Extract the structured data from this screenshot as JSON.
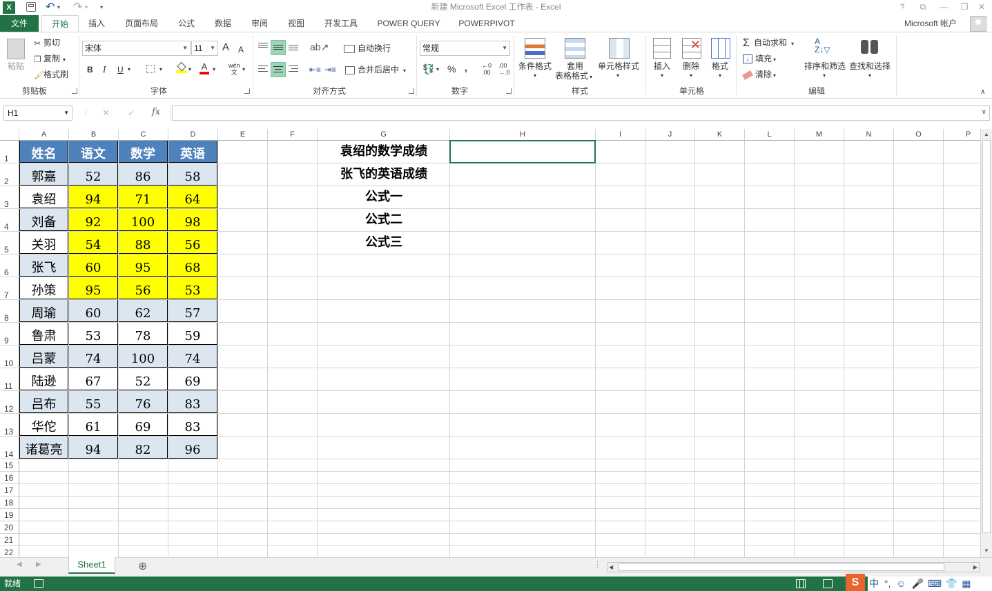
{
  "window": {
    "title": "新建 Microsoft Excel 工作表 - Excel",
    "help": "?",
    "restore_ribbon": "⧉",
    "minimize": "—",
    "maximize": "❐",
    "close": "✕",
    "account": "Microsoft 帐户"
  },
  "qat": {
    "undo": "↶",
    "redo": "↷",
    "more": "▾"
  },
  "tabs": [
    "文件",
    "开始",
    "插入",
    "页面布局",
    "公式",
    "数据",
    "审阅",
    "视图",
    "开发工具",
    "POWER QUERY",
    "POWERPIVOT"
  ],
  "ribbon": {
    "clipboard": {
      "paste": "粘贴",
      "cut": "剪切",
      "copy": "复制",
      "format_painter": "格式刷",
      "label": "剪贴板"
    },
    "font": {
      "name": "宋体",
      "size": "11",
      "grow": "A",
      "shrink": "A",
      "bold": "B",
      "italic": "I",
      "underline": "U",
      "phonetic": "wén",
      "label": "字体"
    },
    "alignment": {
      "wrap": "自动换行",
      "merge": "合并后居中",
      "label": "对齐方式"
    },
    "number": {
      "format": "常规",
      "percent": "%",
      "comma": ",",
      "inc_dec": ".00",
      "label": "数字"
    },
    "styles": {
      "conditional": "条件格式",
      "table_line1": "套用",
      "table_line2": "表格格式",
      "cell_styles": "单元格样式",
      "label": "样式"
    },
    "cells": {
      "insert": "插入",
      "delete": "删除",
      "format": "格式",
      "label": "单元格"
    },
    "editing": {
      "autosum": "自动求和",
      "fill": "填充",
      "clear": "清除",
      "sort": "排序和筛选",
      "find": "查找和选择",
      "label": "编辑"
    }
  },
  "formula_bar": {
    "name_box": "H1",
    "fx": "fx",
    "cancel": "✕",
    "enter": "✓",
    "value": ""
  },
  "columns": [
    "A",
    "B",
    "C",
    "D",
    "E",
    "F",
    "G",
    "H",
    "I",
    "J",
    "K",
    "L",
    "M",
    "N",
    "O",
    "P"
  ],
  "rows": [
    "1",
    "2",
    "3",
    "4",
    "5",
    "6",
    "7",
    "8",
    "9",
    "10",
    "11",
    "12",
    "13",
    "14",
    "15",
    "16",
    "17",
    "18",
    "19",
    "20",
    "21",
    "22"
  ],
  "table": {
    "header": [
      "姓名",
      "语文",
      "数学",
      "英语"
    ],
    "rows": [
      [
        "郭嘉",
        "52",
        "86",
        "58"
      ],
      [
        "袁绍",
        "94",
        "71",
        "64"
      ],
      [
        "刘备",
        "92",
        "100",
        "98"
      ],
      [
        "关羽",
        "54",
        "88",
        "56"
      ],
      [
        "张飞",
        "60",
        "95",
        "68"
      ],
      [
        "孙策",
        "95",
        "56",
        "53"
      ],
      [
        "周瑜",
        "60",
        "62",
        "57"
      ],
      [
        "鲁肃",
        "53",
        "78",
        "59"
      ],
      [
        "吕蒙",
        "74",
        "100",
        "74"
      ],
      [
        "陆逊",
        "67",
        "52",
        "69"
      ],
      [
        "吕布",
        "55",
        "76",
        "83"
      ],
      [
        "华佗",
        "61",
        "69",
        "83"
      ],
      [
        "诸葛亮",
        "94",
        "82",
        "96"
      ]
    ],
    "highlighted_rows": [
      1,
      2,
      3,
      4,
      5
    ],
    "colors": {
      "header_bg": "#4f81bd",
      "band_bg": "#dce6f1",
      "highlight_bg": "#ffff00"
    }
  },
  "g_column": [
    "袁绍的数学成绩",
    "张飞的英语成绩",
    "公式一",
    "公式二",
    "公式三"
  ],
  "sheet_tabs": {
    "active": "Sheet1",
    "add": "⊕"
  },
  "status": {
    "ready": "就绪"
  },
  "ime": {
    "lang": "中",
    "punct": "°,"
  }
}
